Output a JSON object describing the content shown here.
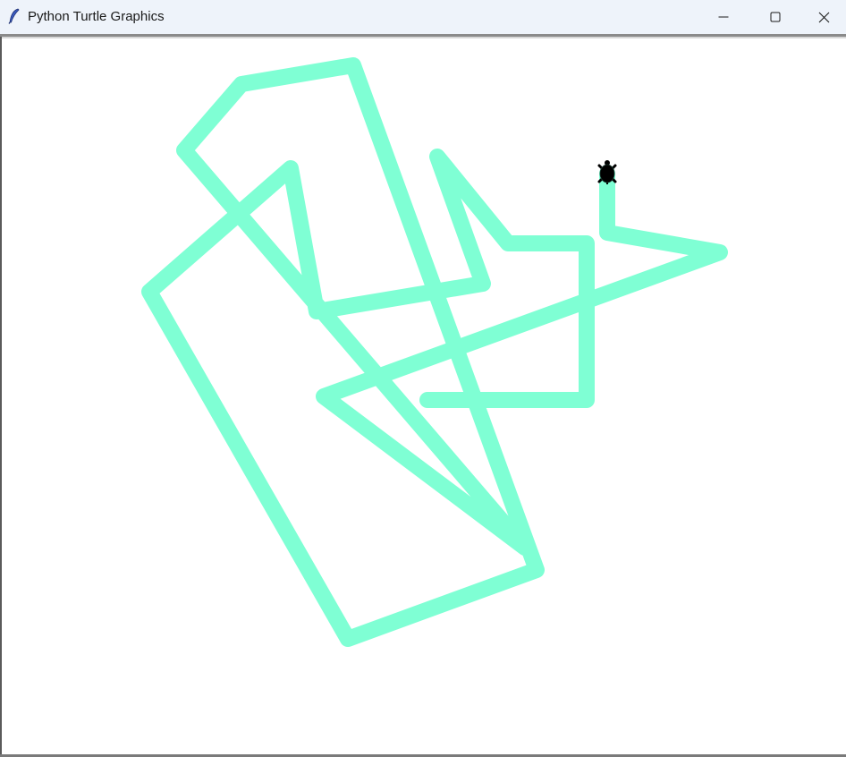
{
  "window": {
    "title": "Python Turtle Graphics",
    "icon": "feather-icon",
    "controls": [
      "minimize-icon",
      "maximize-icon",
      "close-icon"
    ]
  },
  "canvas": {
    "background": "#ffffff",
    "pen_color": "#7fffd4",
    "turtle_color": "#000000"
  }
}
